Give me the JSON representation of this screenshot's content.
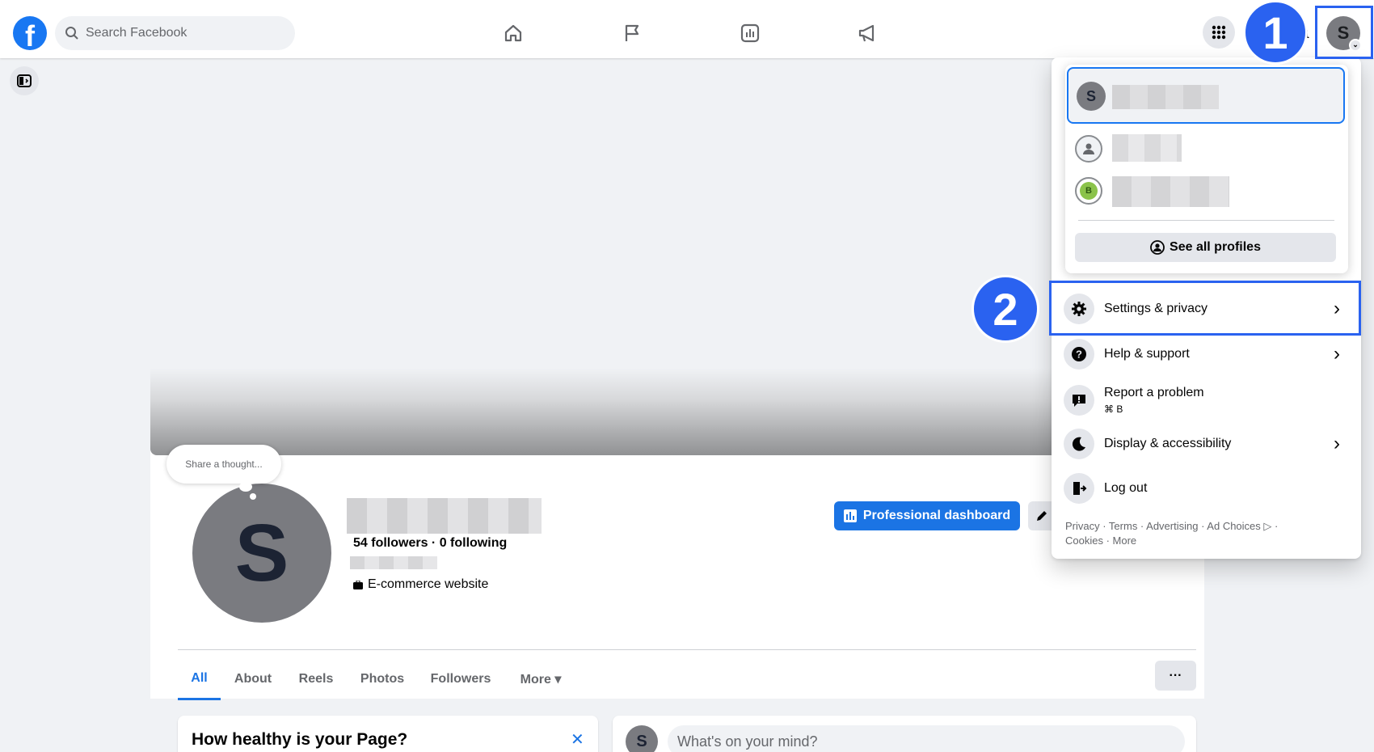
{
  "topbar": {
    "search_placeholder": "Search Facebook",
    "avatar_letter": "S"
  },
  "annotations": {
    "step1": "1",
    "step2": "2"
  },
  "cover": {
    "share_thought": "Share a thought..."
  },
  "profile": {
    "letter": "S",
    "followers_line": "54 followers · 0 following",
    "category": "E-commerce website",
    "professional_dashboard": "Professional dashboard"
  },
  "tabs": [
    {
      "label": "All",
      "active": true
    },
    {
      "label": "About"
    },
    {
      "label": "Reels"
    },
    {
      "label": "Photos"
    },
    {
      "label": "Followers"
    },
    {
      "label": "More ▾"
    }
  ],
  "more_dots": "···",
  "bottom": {
    "health_title": "How healthy is your Page?",
    "close_glyph": "✕",
    "composer_letter": "S",
    "composer_placeholder": "What's on your mind?"
  },
  "dropdown": {
    "profile_letter": "S",
    "second_letter": "B",
    "see_all": "See all profiles",
    "menu": [
      {
        "label": "Settings & privacy",
        "chevron": "›"
      },
      {
        "label": "Help & support",
        "chevron": "›"
      },
      {
        "label": "Report a problem",
        "sub": "⌘ B"
      },
      {
        "label": "Display & accessibility",
        "chevron": "›"
      },
      {
        "label": "Log out"
      }
    ],
    "footer_line1": "Privacy · Terms · Advertising · Ad Choices ▷ ·",
    "footer_line2": "Cookies · More"
  },
  "colors": {
    "accent": "#1877f2",
    "highlight": "#2a62f0"
  }
}
